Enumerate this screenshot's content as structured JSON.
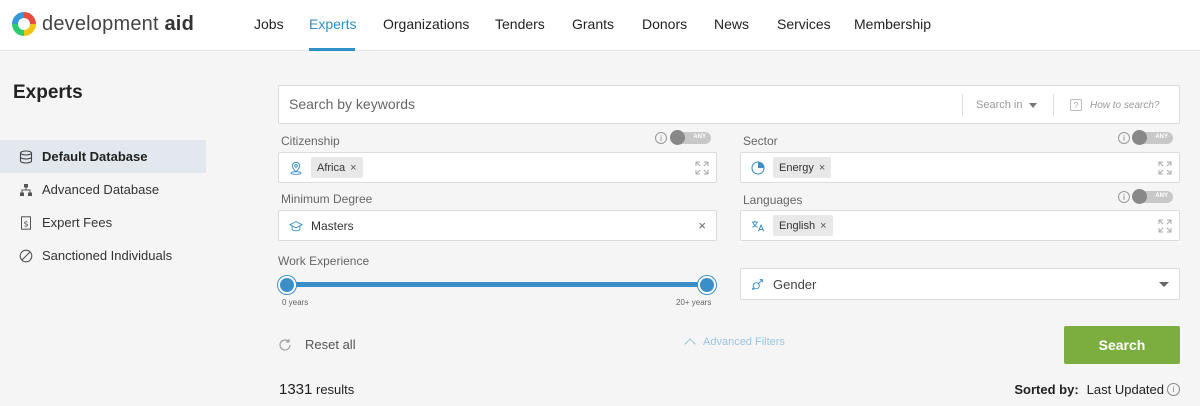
{
  "brand": {
    "name_light": "development ",
    "name_bold": "aid"
  },
  "nav": {
    "items": [
      {
        "label": "Jobs"
      },
      {
        "label": "Experts"
      },
      {
        "label": "Organizations"
      },
      {
        "label": "Tenders"
      },
      {
        "label": "Grants"
      },
      {
        "label": "Donors"
      },
      {
        "label": "News"
      },
      {
        "label": "Services"
      },
      {
        "label": "Membership"
      }
    ],
    "active": "Experts"
  },
  "sidebar": {
    "title": "Experts",
    "items": [
      {
        "label": "Default Database",
        "icon": "database-icon",
        "active": true
      },
      {
        "label": "Advanced Database",
        "icon": "hierarchy-icon"
      },
      {
        "label": "Expert Fees",
        "icon": "dollar-doc-icon"
      },
      {
        "label": "Sanctioned Individuals",
        "icon": "ban-icon"
      }
    ]
  },
  "search": {
    "placeholder": "Search by keywords",
    "search_in": "Search in",
    "help": "How to search?"
  },
  "filters": {
    "citizenship": {
      "label": "Citizenship",
      "toggle": "ANY",
      "chips": [
        "Africa"
      ]
    },
    "sector": {
      "label": "Sector",
      "toggle": "ANY",
      "chips": [
        "Energy"
      ]
    },
    "degree": {
      "label": "Minimum Degree",
      "value": "Masters"
    },
    "languages": {
      "label": "Languages",
      "toggle": "ANY",
      "chips": [
        "English"
      ]
    },
    "experience": {
      "label": "Work Experience",
      "min_label": "0 years",
      "max_label": "20+ years",
      "min": 0,
      "max": 20
    },
    "gender": {
      "placeholder": "Gender"
    }
  },
  "actions": {
    "reset": "Reset all",
    "advanced": "Advanced Filters",
    "search": "Search"
  },
  "results": {
    "count": "1331",
    "label": "results"
  },
  "sort": {
    "label": "Sorted by:",
    "value": "Last Updated"
  },
  "colors": {
    "accent": "#2f8fc7",
    "primary_button": "#7cae3f",
    "slider": "#3a8fc9"
  }
}
